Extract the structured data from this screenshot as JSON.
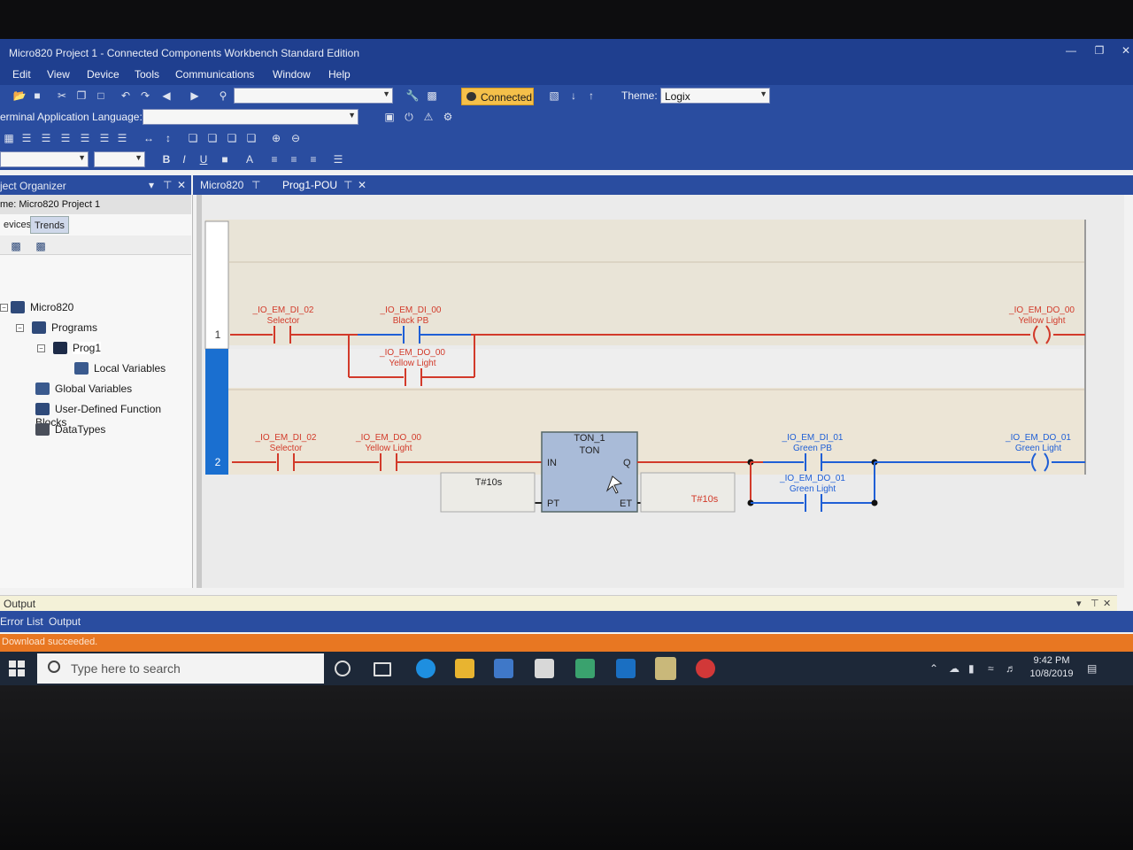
{
  "window": {
    "title": "Micro820 Project 1 - Connected Components Workbench Standard Edition"
  },
  "menu": [
    "Edit",
    "View",
    "Device",
    "Tools",
    "Communications",
    "Window",
    "Help"
  ],
  "toolbar": {
    "connected_label": "Connected",
    "theme_label": "Theme:",
    "theme_value": "Logix",
    "terminal_label": "erminal Application Language:"
  },
  "organizer": {
    "header": "ject Organizer",
    "name": "me:  Micro820 Project 1",
    "tabs": [
      "evices",
      "Trends"
    ],
    "tree": {
      "device": "Micro820",
      "programs": "Programs",
      "prog": "Prog1",
      "local_vars": "Local Variables",
      "global_vars": "Global Variables",
      "udfb": "User-Defined Function Blocks",
      "datatypes": "DataTypes"
    }
  },
  "editor": {
    "tabs": [
      "Micro820",
      "Prog1-POU"
    ]
  },
  "ladder": {
    "rung1": {
      "number": "1",
      "c1_tag": "_IO_EM_DI_02",
      "c1_desc": "Selector",
      "c2_tag": "_IO_EM_DI_00",
      "c2_desc": "Black PB",
      "c3_tag": "_IO_EM_DO_00",
      "c3_desc": "Yellow Light",
      "coil_tag": "_IO_EM_DO_00",
      "coil_desc": "Yellow Light"
    },
    "rung2": {
      "number": "2",
      "c1_tag": "_IO_EM_DI_02",
      "c1_desc": "Selector",
      "c2_tag": "_IO_EM_DO_00",
      "c2_desc": "Yellow Light",
      "ton_name": "TON_1",
      "ton_type": "TON",
      "pin_in": "IN",
      "pin_q": "Q",
      "pin_pt": "PT",
      "pin_et": "ET",
      "pt_value": "T#10s",
      "et_value": "T#10s",
      "c3_tag": "_IO_EM_DI_01",
      "c3_desc": "Green PB",
      "c4_tag": "_IO_EM_DO_01",
      "c4_desc": "Green Light",
      "coil_tag": "_IO_EM_DO_01",
      "coil_desc": "Green Light"
    },
    "colors": {
      "energized": "#1f5fd6",
      "de_energized": "#d23a2a"
    }
  },
  "output": {
    "header": "Output",
    "tabs": [
      "Error List",
      "Output"
    ],
    "status": "Download succeeded."
  },
  "taskbar": {
    "search_placeholder": "Type here to search",
    "time": "9:42 PM",
    "date": "10/8/2019"
  }
}
